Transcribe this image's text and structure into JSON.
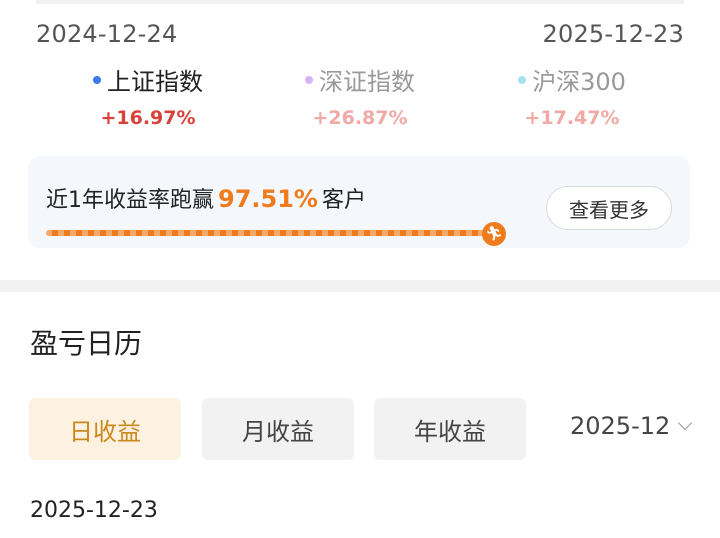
{
  "range": {
    "start": "2024-12-24",
    "end": "2025-12-23"
  },
  "legend": [
    {
      "name": "上证指数",
      "value": "+16.97%",
      "dot_color": "#3a7bf5",
      "value_color": "#d9423b",
      "name_color": "#222222"
    },
    {
      "name": "深证指数",
      "value": "+26.87%",
      "dot_color": "#d8b4f0",
      "value_color": "#f0a9a4",
      "name_color": "#999999"
    },
    {
      "name": "沪深300",
      "value": "+17.47%",
      "dot_color": "#a9def5",
      "value_color": "#f0a9a4",
      "name_color": "#999999"
    }
  ],
  "ranking": {
    "prefix": "近1年收益率跑赢",
    "percent": "97.51%",
    "suffix": "客户",
    "more_label": "查看更多",
    "progress": 0.9751,
    "accent": "#f07b1d"
  },
  "calendar": {
    "title": "盈亏日历",
    "tabs": [
      {
        "label": "日收益",
        "active": true
      },
      {
        "label": "月收益",
        "active": false
      },
      {
        "label": "年收益",
        "active": false
      }
    ],
    "month": "2025-12",
    "selected_date": "2025-12-23"
  }
}
